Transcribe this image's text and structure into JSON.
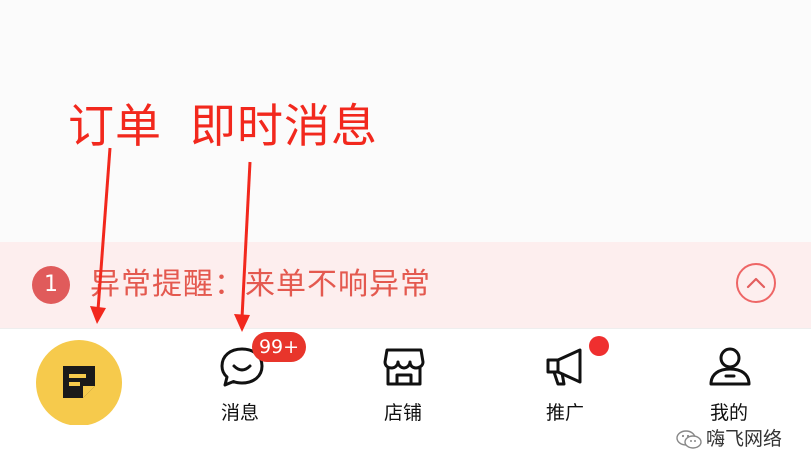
{
  "annotations": {
    "orders": "订单",
    "messages": "即时消息"
  },
  "alert": {
    "number": "1",
    "text": "异常提醒：来单不响异常",
    "toggle_icon": "chevron-up-icon"
  },
  "tabs": [
    {
      "label": "",
      "icon": "orders-note-icon"
    },
    {
      "label": "消息",
      "icon": "chat-bubble-icon",
      "badge": "99+"
    },
    {
      "label": "店铺",
      "icon": "store-icon"
    },
    {
      "label": "推广",
      "icon": "megaphone-icon",
      "dot": true
    },
    {
      "label": "我的",
      "icon": "user-icon"
    }
  ],
  "watermark": {
    "text": "嗨飞网络",
    "icon": "wechat-icon"
  },
  "colors": {
    "accent_red": "#f2281d",
    "alert_bg": "#fdeeee",
    "alert_text": "#e4594f",
    "orders_yellow": "#f6ca4c",
    "badge_red": "#e8352b"
  }
}
